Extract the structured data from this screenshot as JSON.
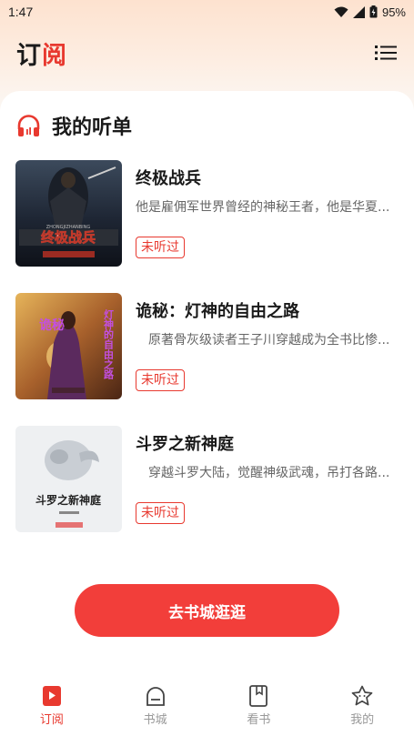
{
  "status_bar": {
    "time": "1:47",
    "battery": "95%"
  },
  "header": {
    "title_part1": "订",
    "title_part2": "阅",
    "menu_icon": "list-menu-icon"
  },
  "section": {
    "icon": "headphones-icon",
    "title": "我的听单"
  },
  "books": [
    {
      "title": "终极战兵",
      "desc": "他是雇佣军世界曾经的神秘王者，他是华夏...",
      "status": "未听过",
      "cover_text": "终极战兵",
      "cover_sub": "ZHONGJIZHANBING"
    },
    {
      "title": "诡秘：灯神的自由之路",
      "desc": "　原著骨灰级读者王子川穿越成为全书比惨...",
      "status": "未听过",
      "cover_text": "诡秘",
      "cover_sub": "灯神的自由之路"
    },
    {
      "title": "斗罗之新神庭",
      "desc": "　穿越斗罗大陆，觉醒神级武魂，吊打各路...",
      "status": "未听过",
      "cover_text": "斗罗之新神庭",
      "cover_sub": ""
    }
  ],
  "cta": {
    "label": "去书城逛逛"
  },
  "nav": [
    {
      "label": "订阅",
      "icon": "bookmark-icon",
      "active": true
    },
    {
      "label": "书城",
      "icon": "store-icon",
      "active": false
    },
    {
      "label": "看书",
      "icon": "book-icon",
      "active": false
    },
    {
      "label": "我的",
      "icon": "profile-star-icon",
      "active": false
    }
  ],
  "colors": {
    "accent": "#e8392f",
    "cta": "#f23e3a",
    "inactive": "#999999"
  }
}
